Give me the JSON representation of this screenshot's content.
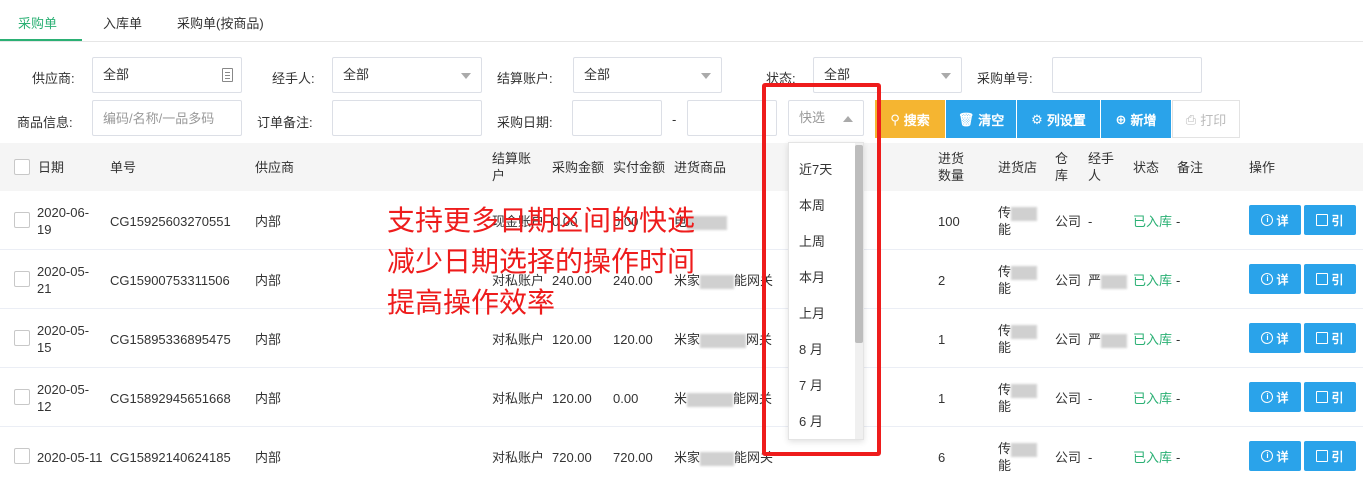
{
  "tabs": [
    {
      "label": "采购单",
      "active": true
    },
    {
      "label": "入库单",
      "active": false
    },
    {
      "label": "采购单(按商品)",
      "active": false
    }
  ],
  "filters": {
    "supplier_label": "供应商:",
    "supplier_value": "全部",
    "handler_label": "经手人:",
    "handler_value": "全部",
    "account_label": "结算账户:",
    "account_value": "全部",
    "status_label": "状态:",
    "status_value": "全部",
    "order_no_label": "采购单号:",
    "product_label": "商品信息:",
    "product_placeholder": "编码/名称/一品多码",
    "remark_label": "订单备注:",
    "date_label": "采购日期:",
    "date_separator": "-",
    "quick_placeholder": "快选"
  },
  "buttons": {
    "search": "搜索",
    "clear": "清空",
    "columns": "列设置",
    "new": "新增",
    "print": "打印"
  },
  "table": {
    "headers": {
      "date": "日期",
      "order_no": "单号",
      "supplier": "供应商",
      "account": "结算账户",
      "amount": "采购金额",
      "paid": "实付金额",
      "product": "进货商品",
      "qty": "进货数量",
      "store": "进货店",
      "warehouse": "仓库",
      "handler": "经手人",
      "status": "状态",
      "remark": "备注",
      "ops": "操作"
    },
    "rows": [
      {
        "date": "2020-06-19",
        "order_no": "CG15925603270551",
        "supplier": "内部",
        "account": "现金账户",
        "amount": "0.00",
        "paid": "0.00",
        "product": "电",
        "qty": "100",
        "store_a": "传",
        "store_b": "能",
        "warehouse": "公司",
        "handler": "-",
        "status": "已入库",
        "remark": "-"
      },
      {
        "date": "2020-05-21",
        "order_no": "CG15900753311506",
        "supplier": "内部",
        "account": "对私账户",
        "amount": "240.00",
        "paid": "240.00",
        "product_a": "米家",
        "product_b": "能网关",
        "qty": "2",
        "store_a": "传",
        "store_b": "能",
        "warehouse": "公司",
        "handler": "严",
        "status": "已入库",
        "remark": "-"
      },
      {
        "date": "2020-05-15",
        "order_no": "CG15895336895475",
        "supplier": "内部",
        "account": "对私账户",
        "amount": "120.00",
        "paid": "120.00",
        "product_a": "米家",
        "product_b": "网关",
        "qty": "1",
        "store_a": "传",
        "store_b": "能",
        "warehouse": "公司",
        "handler": "严",
        "status": "已入库",
        "remark": "-"
      },
      {
        "date": "2020-05-12",
        "order_no": "CG15892945651668",
        "supplier": "内部",
        "account": "对私账户",
        "amount": "120.00",
        "paid": "0.00",
        "product_a": "米",
        "product_b": "能网关",
        "qty": "1",
        "store_a": "传",
        "store_b": "能",
        "warehouse": "公司",
        "handler": "-",
        "status": "已入库",
        "remark": "-"
      },
      {
        "date": "2020-05-11",
        "order_no": "CG15892140624185",
        "supplier": "内部",
        "account": "对私账户",
        "amount": "720.00",
        "paid": "720.00",
        "product_a": "米家",
        "product_b": "能网关",
        "qty": "6",
        "store_a": "传",
        "store_b": "能",
        "warehouse": "公司",
        "handler": "-",
        "status": "已入库",
        "remark": "-"
      }
    ],
    "op_detail": "详",
    "op_ref": "引"
  },
  "quick_dropdown": {
    "options": [
      "近7天",
      "本周",
      "上周",
      "本月",
      "上月",
      "8 月",
      "7 月",
      "6 月"
    ]
  },
  "annotation": {
    "line1": "支持更多日期区间的快选",
    "line2": "减少日期选择的操作时间",
    "line3": "提高操作效率"
  },
  "colors": {
    "accent_green": "#2bb074",
    "button_blue": "#2aa3ea",
    "button_orange": "#f5b531",
    "annotation_red": "#ee1c1c"
  }
}
